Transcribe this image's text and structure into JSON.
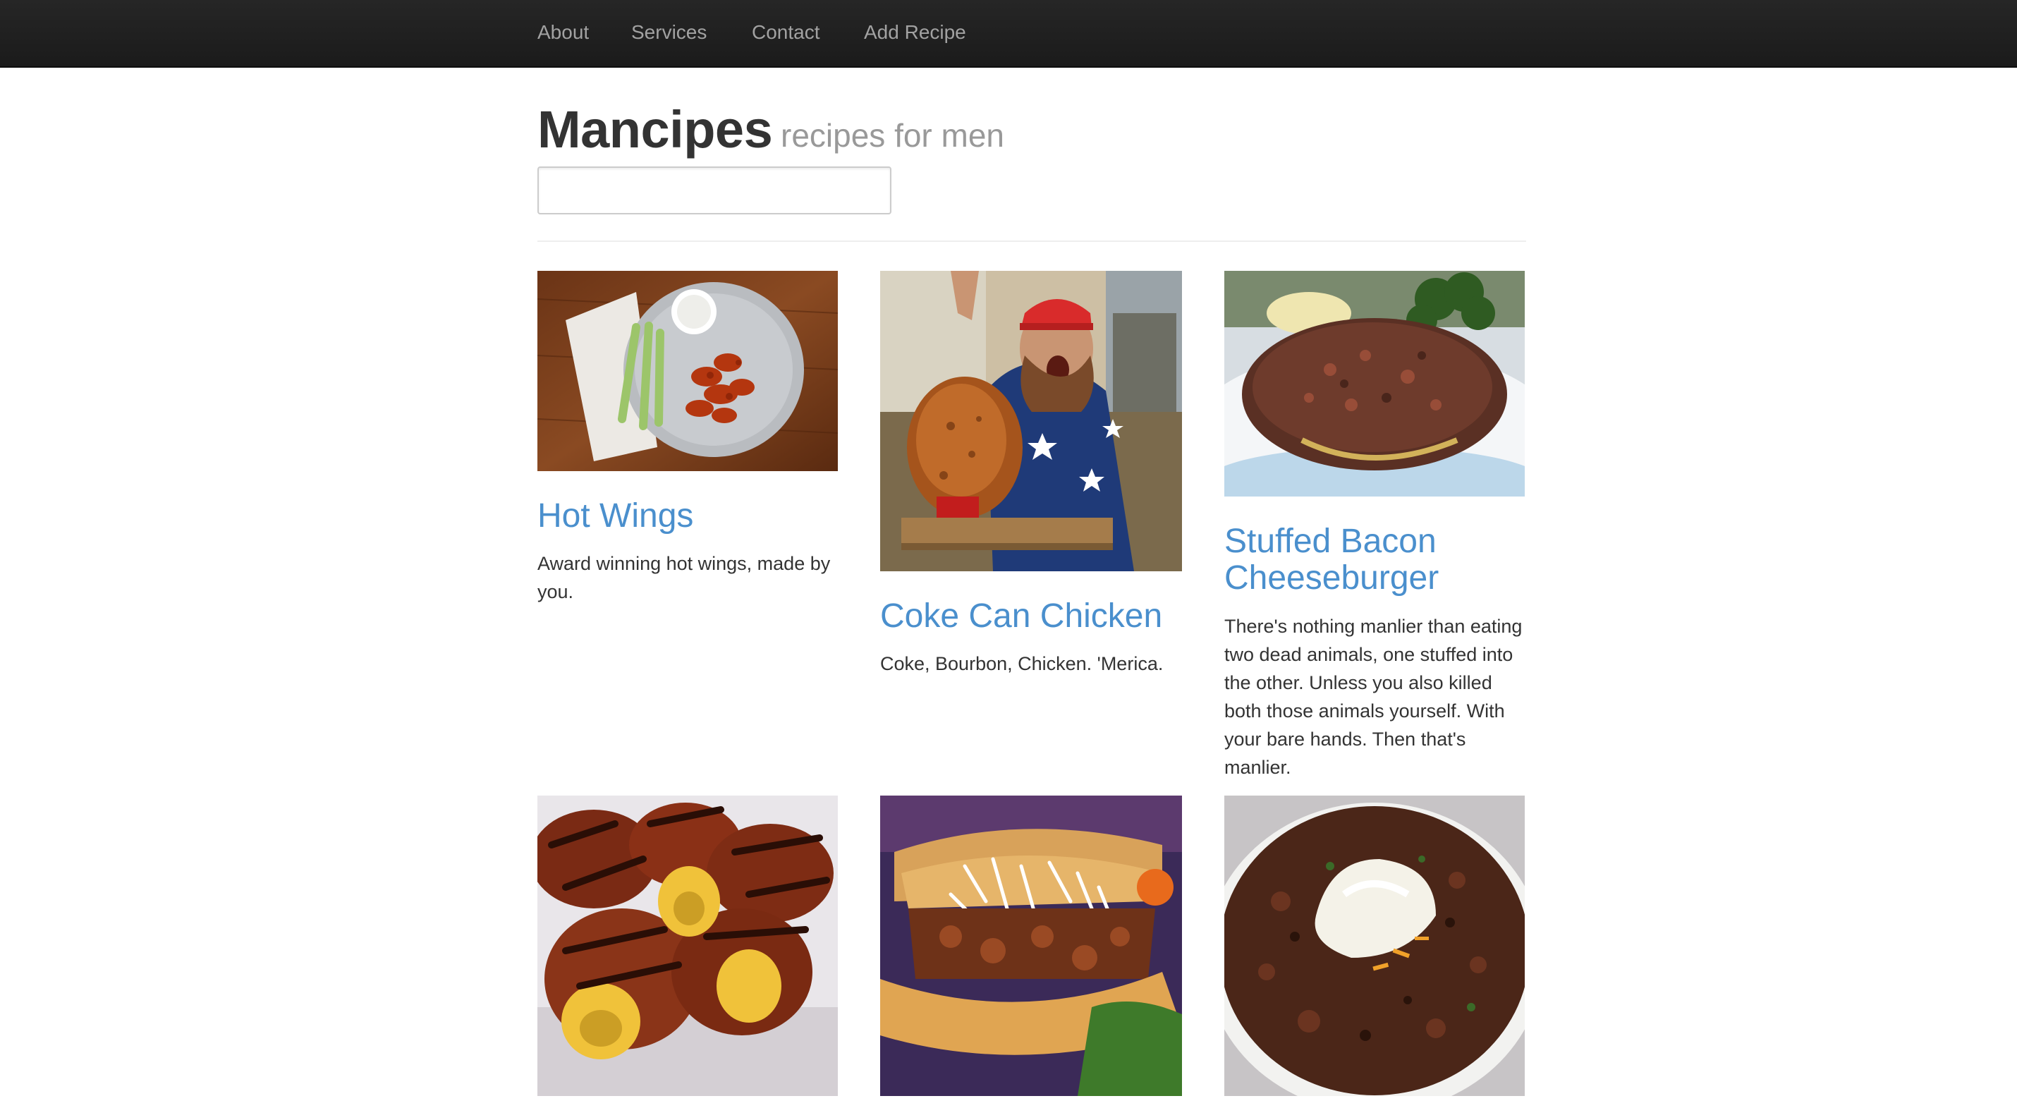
{
  "nav": {
    "items": [
      {
        "label": "About"
      },
      {
        "label": "Services"
      },
      {
        "label": "Contact"
      },
      {
        "label": "Add Recipe"
      }
    ]
  },
  "header": {
    "title": "Mancipes",
    "tagline": "recipes for men",
    "search_value": "",
    "search_placeholder": ""
  },
  "recipes": [
    {
      "title": "Hot Wings",
      "description": "Award winning hot wings, made by you."
    },
    {
      "title": "Coke Can Chicken",
      "description": "Coke, Bourbon, Chicken. 'Merica."
    },
    {
      "title": "Stuffed Bacon Cheeseburger",
      "description": "There's nothing manlier than eating two dead animals, one stuffed into the other. Unless you also killed both those animals yourself. With your bare hands. Then that's manlier."
    },
    {
      "title": "",
      "description": ""
    },
    {
      "title": "",
      "description": ""
    },
    {
      "title": "",
      "description": ""
    }
  ],
  "colors": {
    "navbar": "#1b1b1b",
    "nav_text": "#a2a2a2",
    "link": "#4a8fcd",
    "title": "#333333",
    "tagline": "#999999"
  }
}
